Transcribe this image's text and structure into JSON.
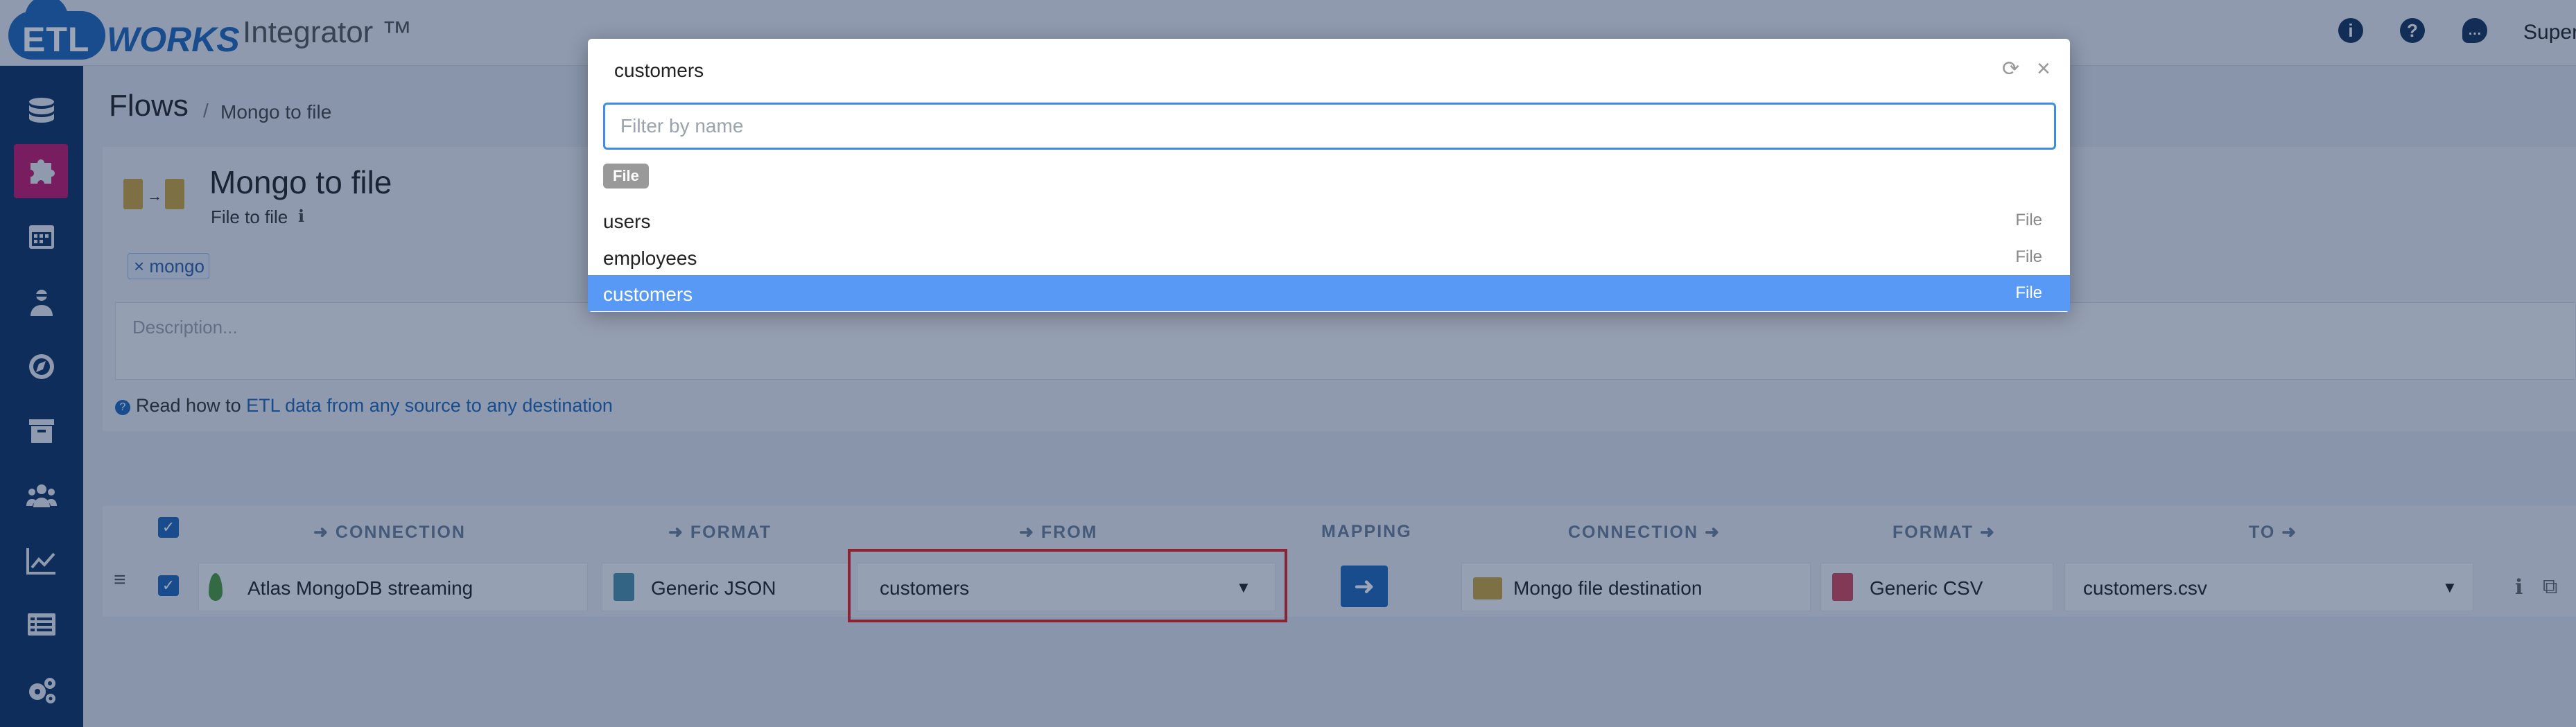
{
  "header": {
    "logo_etl": "ETL",
    "logo_works": "WORKS",
    "app_title": "Integrator ™",
    "user": "Super"
  },
  "breadcrumb": {
    "root": "Flows",
    "separator": "/",
    "current": "Mongo to file"
  },
  "flow": {
    "name": "Mongo to file",
    "type": "File to file",
    "tag": "mongo",
    "tag_remove": "×",
    "description_placeholder": "Description...",
    "help_prefix": "Read how to",
    "help_link": "ETL data from any source to any destination"
  },
  "grid": {
    "headers": {
      "connection": "CONNECTION",
      "format": "FORMAT",
      "from": "FROM",
      "mapping": "MAPPING",
      "connection_to": "CONNECTION",
      "format_to": "FORMAT",
      "to": "TO"
    },
    "row": {
      "source_connection": "Atlas MongoDB streaming",
      "source_format": "Generic JSON",
      "from": "customers",
      "dest_connection": "Mongo file destination",
      "dest_format": "Generic CSV",
      "to": "customers.csv"
    }
  },
  "modal": {
    "title": "customers",
    "filter_placeholder": "Filter by name",
    "filter_badge": "File",
    "items": [
      {
        "name": "users",
        "type": "File"
      },
      {
        "name": "employees",
        "type": "File"
      },
      {
        "name": "customers",
        "type": "File"
      }
    ],
    "selected_index": 2
  },
  "colors": {
    "sidebar": "#0c3161",
    "active": "#c2166a",
    "accent": "#1c67b7",
    "selection": "#5899f5",
    "highlight_box": "#e02020"
  }
}
